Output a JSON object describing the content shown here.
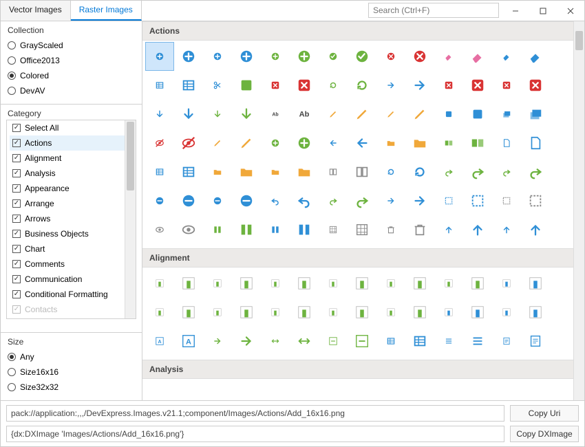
{
  "tabs": {
    "vector": "Vector Images",
    "raster": "Raster Images"
  },
  "search": {
    "placeholder": "Search (Ctrl+F)"
  },
  "sidebar": {
    "collection": {
      "label": "Collection",
      "items": [
        {
          "label": "GrayScaled",
          "checked": false
        },
        {
          "label": "Office2013",
          "checked": false
        },
        {
          "label": "Colored",
          "checked": true
        },
        {
          "label": "DevAV",
          "checked": false
        }
      ]
    },
    "category": {
      "label": "Category",
      "items": [
        {
          "label": "Select All",
          "checked": true,
          "selected": false
        },
        {
          "label": "Actions",
          "checked": true,
          "selected": true
        },
        {
          "label": "Alignment",
          "checked": true
        },
        {
          "label": "Analysis",
          "checked": true
        },
        {
          "label": "Appearance",
          "checked": true
        },
        {
          "label": "Arrange",
          "checked": true
        },
        {
          "label": "Arrows",
          "checked": true
        },
        {
          "label": "Business Objects",
          "checked": true
        },
        {
          "label": "Chart",
          "checked": true
        },
        {
          "label": "Comments",
          "checked": true
        },
        {
          "label": "Communication",
          "checked": true
        },
        {
          "label": "Conditional Formatting",
          "checked": true
        },
        {
          "label": "Contacts",
          "checked": true,
          "disabled": true
        }
      ]
    },
    "size": {
      "label": "Size",
      "items": [
        {
          "label": "Any",
          "checked": true
        },
        {
          "label": "Size16x16",
          "checked": false
        },
        {
          "label": "Size32x32",
          "checked": false
        }
      ]
    }
  },
  "groups": {
    "actions": "Actions",
    "alignment": "Alignment",
    "analysis": "Analysis"
  },
  "footer": {
    "uri": "pack://application:,,,/DevExpress.Images.v21.1;component/Images/Actions/Add_16x16.png",
    "dx": "{dx:DXImage 'Images/Actions/Add_16x16.png'}",
    "copy_uri": "Copy Uri",
    "copy_dx": "Copy DXImage"
  },
  "colors": {
    "blue": "#2f8fd6",
    "green": "#6db33f",
    "red": "#d93434",
    "orange": "#f0a83a",
    "pink": "#e76fa3",
    "gray": "#8a8a8a",
    "dark": "#444"
  },
  "icons": {
    "actions": [
      [
        "add-small",
        "plus",
        "blue",
        "circle"
      ],
      [
        "add",
        "plus",
        "blue",
        "circle-big"
      ],
      [
        "add-file-sm",
        "plus",
        "blue",
        "file"
      ],
      [
        "add-file",
        "plus",
        "blue",
        "file-big"
      ],
      [
        "add-doc-sm",
        "plus",
        "green",
        "file"
      ],
      [
        "add-doc",
        "plus",
        "green",
        "file-big"
      ],
      [
        "apply-sm",
        "check",
        "green",
        "circle"
      ],
      [
        "apply",
        "check",
        "green",
        "circle-big"
      ],
      [
        "cancel-sm",
        "x",
        "red",
        "circle"
      ],
      [
        "cancel",
        "x",
        "red",
        "circle-big"
      ],
      [
        "clear-sm",
        "eraser",
        "pink",
        "shape"
      ],
      [
        "clear",
        "eraser",
        "pink",
        "shape-big"
      ],
      [
        "clear-fmt-sm",
        "eraser",
        "blue",
        "cell"
      ],
      [
        "clear-fmt",
        "eraser",
        "blue",
        "cell-big"
      ],
      [
        "clear-tbl-sm",
        "table",
        "blue",
        "cell"
      ],
      [
        "clear-tbl",
        "table",
        "blue",
        "cell-big"
      ],
      [
        "clear-tbl-style",
        "scissors",
        "blue",
        "cell"
      ],
      [
        "clip-sm",
        "clip",
        "green",
        "sq"
      ],
      [
        "clip",
        "x",
        "red",
        "sq"
      ],
      [
        "close",
        "x",
        "red",
        "sq-big"
      ],
      [
        "convert-sm",
        "refresh",
        "green",
        "sq"
      ],
      [
        "convert",
        "refresh",
        "green",
        "sq-big"
      ],
      [
        "convert-tbl-sm",
        "arrow-r",
        "blue",
        "table"
      ],
      [
        "convert-tbl",
        "arrow-r",
        "blue",
        "table-big"
      ],
      [
        "del-data-sm",
        "x",
        "red",
        "file"
      ],
      [
        "del-data",
        "x",
        "red",
        "file-big"
      ],
      [
        "del-list-sm",
        "x",
        "red",
        "list"
      ],
      [
        "del-list",
        "x",
        "red",
        "list-big"
      ],
      [
        "dl-sm",
        "down",
        "blue",
        "box"
      ],
      [
        "dl",
        "down",
        "blue",
        "box-big"
      ],
      [
        "dl2-sm",
        "down",
        "green",
        "arrow"
      ],
      [
        "dl2",
        "down",
        "green",
        "arrow-big"
      ],
      [
        "drill-sm",
        "ab",
        "dark",
        "text"
      ],
      [
        "drill",
        "ab",
        "dark",
        "text-big"
      ],
      [
        "edit-sm",
        "pencil",
        "orange",
        "sq"
      ],
      [
        "edit",
        "pencil",
        "orange",
        "sq-big"
      ],
      [
        "edit-tbl-sm",
        "pencil",
        "orange",
        "table"
      ],
      [
        "edit-tbl",
        "pencil",
        "orange",
        "table-big"
      ],
      [
        "group-sm",
        "sq",
        "blue",
        "pair"
      ],
      [
        "group",
        "sq",
        "blue",
        "pair-big"
      ],
      [
        "layers-sm",
        "stack",
        "blue",
        "sq"
      ],
      [
        "layers",
        "stack",
        "blue",
        "sq-big"
      ],
      [
        "hide-sm",
        "eye-off",
        "red",
        "shape"
      ],
      [
        "hide",
        "eye-off",
        "red",
        "shape-big"
      ],
      [
        "img-edit-sm",
        "pencil",
        "orange",
        "image"
      ],
      [
        "img-edit",
        "pencil",
        "orange",
        "image-big"
      ],
      [
        "insert-sm",
        "plus",
        "green",
        "page"
      ],
      [
        "insert",
        "plus",
        "green",
        "page-big"
      ],
      [
        "back-sm",
        "arrow-l",
        "blue",
        "box"
      ],
      [
        "back",
        "arrow-l",
        "blue",
        "box-big"
      ],
      [
        "folder-sm",
        "folder",
        "orange",
        "shape"
      ],
      [
        "folder",
        "folder",
        "orange",
        "shape-big"
      ],
      [
        "merge-sm",
        "merge",
        "green",
        "sq"
      ],
      [
        "merge",
        "merge",
        "green",
        "sq-big"
      ],
      [
        "new-sm",
        "page",
        "blue",
        "blank"
      ],
      [
        "new",
        "page",
        "blue",
        "blank-big"
      ],
      [
        "new-tbl-sm",
        "table",
        "blue",
        "plus"
      ],
      [
        "new-tbl",
        "table",
        "blue",
        "plus-big"
      ],
      [
        "open-sm",
        "folder",
        "orange",
        "open"
      ],
      [
        "open",
        "folder",
        "orange",
        "open-big"
      ],
      [
        "open2-sm",
        "folder",
        "orange",
        "open2"
      ],
      [
        "open2",
        "folder",
        "orange",
        "open2-big"
      ],
      [
        "book-sm",
        "book",
        "gray",
        "shape"
      ],
      [
        "book",
        "book",
        "gray",
        "shape-big"
      ],
      [
        "refresh-sm",
        "refresh",
        "blue",
        "circle"
      ],
      [
        "refresh",
        "refresh",
        "blue",
        "circle-big"
      ],
      [
        "redo-sm",
        "redo",
        "green",
        "arrow"
      ],
      [
        "redo",
        "redo",
        "green",
        "arrow-big"
      ],
      [
        "redo2-sm",
        "redo",
        "green",
        "circle"
      ],
      [
        "redo2",
        "redo",
        "green",
        "circle-big"
      ],
      [
        "remove-sm",
        "minus",
        "blue",
        "circle"
      ],
      [
        "remove",
        "minus",
        "blue",
        "circle-big"
      ],
      [
        "rm-file-sm",
        "minus",
        "blue",
        "file"
      ],
      [
        "rm-file",
        "minus",
        "blue",
        "file-big"
      ],
      [
        "undo-sm",
        "undo",
        "blue",
        "arrow"
      ],
      [
        "undo",
        "undo",
        "blue",
        "arrow-big"
      ],
      [
        "reset-sm",
        "redo",
        "green",
        "arrow2"
      ],
      [
        "reset",
        "redo",
        "green",
        "arrow2-big"
      ],
      [
        "fwd-sm",
        "arrow-r",
        "blue",
        "box"
      ],
      [
        "fwd",
        "arrow-r",
        "blue",
        "box-big"
      ],
      [
        "select-sm",
        "marquee",
        "blue",
        "dash"
      ],
      [
        "select",
        "marquee",
        "blue",
        "dash-big"
      ],
      [
        "sel-all-sm",
        "marquee",
        "gray",
        "dash2"
      ],
      [
        "sel-all",
        "marquee",
        "gray",
        "dash2-big"
      ],
      [
        "show-sm",
        "eye",
        "gray",
        "shape"
      ],
      [
        "show",
        "eye",
        "gray",
        "shape-big"
      ],
      [
        "split-h-sm",
        "split",
        "green",
        "bars"
      ],
      [
        "split-h",
        "split",
        "green",
        "bars-big"
      ],
      [
        "split-v-sm",
        "split",
        "blue",
        "barsv"
      ],
      [
        "split-v",
        "split",
        "blue",
        "barsv-big"
      ],
      [
        "grid-sm",
        "grid",
        "gray",
        "sq"
      ],
      [
        "grid",
        "grid",
        "gray",
        "sq-big"
      ],
      [
        "trash-sm",
        "trash",
        "gray",
        "shape"
      ],
      [
        "trash",
        "trash",
        "gray",
        "shape-big"
      ],
      [
        "up-sm",
        "up",
        "blue",
        "arrow"
      ],
      [
        "up",
        "up",
        "blue",
        "arrow-big"
      ],
      [
        "up2-sm",
        "up",
        "blue",
        "arrow2"
      ],
      [
        "up2",
        "up",
        "blue",
        "arrow2-big"
      ]
    ],
    "alignment": [
      [
        "al-bc-sm",
        "bar",
        "green",
        "bc"
      ],
      [
        "al-bc",
        "bar",
        "green",
        "bc-b"
      ],
      [
        "al-bl-sm",
        "bar",
        "green",
        "bl"
      ],
      [
        "al-bl",
        "bar",
        "green",
        "bl-b"
      ],
      [
        "al-br-sm",
        "bar",
        "green",
        "br"
      ],
      [
        "al-br",
        "bar",
        "green",
        "br-b"
      ],
      [
        "al-cc-sm",
        "bar",
        "green",
        "cc"
      ],
      [
        "al-cc",
        "bar",
        "green",
        "cc-b"
      ],
      [
        "al-cl-sm",
        "bar",
        "green",
        "cl"
      ],
      [
        "al-cl",
        "bar",
        "green",
        "cl-b"
      ],
      [
        "al-cr-sm",
        "bar",
        "green",
        "cr"
      ],
      [
        "al-cr",
        "bar",
        "green",
        "cr-b"
      ],
      [
        "al-hc-sm",
        "bar",
        "blue",
        "hc"
      ],
      [
        "al-hc",
        "bar",
        "blue",
        "hc-b"
      ],
      [
        "al-hc2-sm",
        "bar",
        "green",
        "hc2"
      ],
      [
        "al-hc2",
        "bar",
        "green",
        "hc2-b"
      ],
      [
        "al-hl-sm",
        "bar",
        "green",
        "hl"
      ],
      [
        "al-hl",
        "bar",
        "green",
        "hl-b"
      ],
      [
        "al-hr-sm",
        "bar",
        "green",
        "hr"
      ],
      [
        "al-hr",
        "bar",
        "green",
        "hr-b"
      ],
      [
        "al-jc-sm",
        "bar",
        "green",
        "jc"
      ],
      [
        "al-jc",
        "bar",
        "green",
        "jc-b"
      ],
      [
        "al-jl-sm",
        "bar",
        "green",
        "jl"
      ],
      [
        "al-jl",
        "bar",
        "green",
        "jl-b"
      ],
      [
        "al-tc-sm",
        "bar",
        "blue",
        "tc"
      ],
      [
        "al-tc",
        "bar",
        "blue",
        "tc-b"
      ],
      [
        "al-tl-sm",
        "bar",
        "blue",
        "tl"
      ],
      [
        "al-tl",
        "bar",
        "blue",
        "tl-b"
      ],
      [
        "al-txt-sm",
        "a",
        "blue",
        "sq"
      ],
      [
        "al-txt",
        "a",
        "blue",
        "sq-b"
      ],
      [
        "al-v-sm",
        "arrow-r",
        "green",
        "bar"
      ],
      [
        "al-v",
        "arrow-r",
        "green",
        "bar-b"
      ],
      [
        "al-v2-sm",
        "arrow-lr",
        "green",
        "bar"
      ],
      [
        "al-v2",
        "arrow-lr",
        "green",
        "bar-b"
      ],
      [
        "al-fit-sm",
        "fit",
        "green",
        "box"
      ],
      [
        "al-fit",
        "fit",
        "green",
        "box-b"
      ],
      [
        "al-tbl-sm",
        "table",
        "blue",
        "sq"
      ],
      [
        "al-tbl",
        "table",
        "blue",
        "sq-b"
      ],
      [
        "al-list-sm",
        "list",
        "blue",
        "sq"
      ],
      [
        "al-list",
        "list",
        "blue",
        "sq-b"
      ],
      [
        "al-doc-sm",
        "doc",
        "blue",
        "sq"
      ],
      [
        "al-doc",
        "doc",
        "blue",
        "sq-b"
      ]
    ]
  }
}
